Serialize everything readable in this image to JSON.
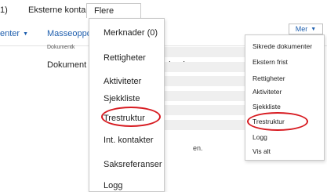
{
  "tabs": [
    {
      "label": "1)"
    },
    {
      "label": "Eksterne kontakter"
    },
    {
      "label": "Flere faner"
    }
  ],
  "toolbar": {
    "left_label": "enter",
    "mass_update_label": "Masseoppdate"
  },
  "form": {
    "small_label": "Dokumentk",
    "doc_label": "Dokument",
    "doc_value": "eland",
    "note_fragment": "en."
  },
  "flere_faner_menu": {
    "items": [
      {
        "label": "Merknader (0)"
      },
      {
        "label": "Rettigheter"
      },
      {
        "label": "Aktiviteter"
      },
      {
        "label": "Sjekkliste"
      },
      {
        "label": "Trestruktur",
        "highlighted": true
      },
      {
        "label": "Int. kontakter"
      },
      {
        "label": "Saksreferanser"
      },
      {
        "label": "Logg"
      }
    ]
  },
  "mer_button": {
    "label": "Mer"
  },
  "mer_menu": {
    "items": [
      {
        "label": "Sikrede dokumenter"
      },
      {
        "label": "Ekstern frist"
      },
      {
        "label": "Rettigheter"
      },
      {
        "label": "Aktiviteter"
      },
      {
        "label": "Sjekkliste"
      },
      {
        "label": "Trestruktur",
        "highlighted": true
      },
      {
        "label": "Logg"
      },
      {
        "label": "Vis alt"
      }
    ]
  },
  "colors": {
    "link": "#1f5fae",
    "highlight_circle": "#d71a20",
    "border": "#c9c9c9"
  }
}
